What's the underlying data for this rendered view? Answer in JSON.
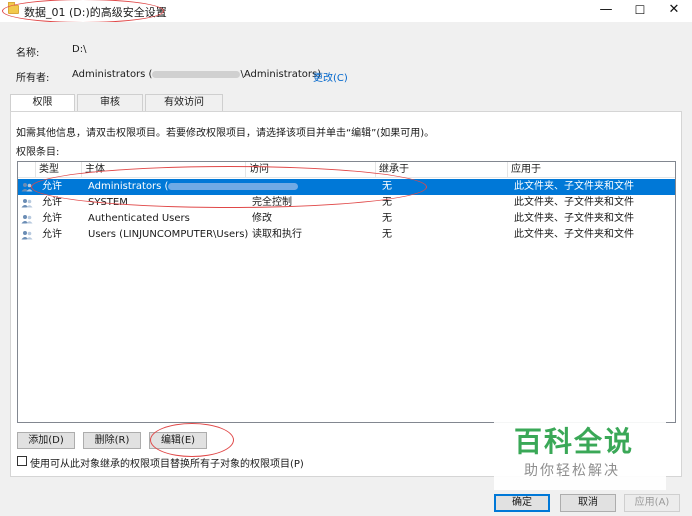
{
  "window": {
    "title": "数据_01 (D:)的高级安全设置",
    "minimize_glyph": "—",
    "maximize_glyph": "☐",
    "close_glyph": "✕"
  },
  "info": {
    "name_label": "名称:",
    "name_value": "D:\\",
    "owner_label": "所有者:",
    "owner_prefix": "Administrators (",
    "owner_suffix": "\\Administrators)",
    "change_link": "更改(C)"
  },
  "tabs": [
    {
      "label": "权限",
      "active": true
    },
    {
      "label": "审核",
      "active": false
    },
    {
      "label": "有效访问",
      "active": false
    }
  ],
  "panel": {
    "instruction": "如需其他信息，请双击权限项目。若要修改权限项目，请选择该项目并单击“编辑”(如果可用)。",
    "entries_label": "权限条目:"
  },
  "table": {
    "columns": [
      "类型",
      "主体",
      "访问",
      "继承于",
      "应用于"
    ],
    "rows": [
      {
        "type": "允许",
        "principal": "Administrators (",
        "access": "",
        "inherited": "无",
        "applies": "此文件夹、子文件夹和文件",
        "selected": true
      },
      {
        "type": "允许",
        "principal": "SYSTEM",
        "access": "完全控制",
        "inherited": "无",
        "applies": "此文件夹、子文件夹和文件",
        "selected": false
      },
      {
        "type": "允许",
        "principal": "Authenticated Users",
        "access": "修改",
        "inherited": "无",
        "applies": "此文件夹、子文件夹和文件",
        "selected": false
      },
      {
        "type": "允许",
        "principal": "Users (LINJUNCOMPUTER\\Users)",
        "access": "读取和执行",
        "inherited": "无",
        "applies": "此文件夹、子文件夹和文件",
        "selected": false
      }
    ]
  },
  "actions": {
    "add": "添加(D)",
    "remove": "删除(R)",
    "edit": "编辑(E)"
  },
  "checkbox_label": "使用可从此对象继承的权限项目替换所有子对象的权限项目(P)",
  "footer": {
    "ok": "确定",
    "cancel": "取消",
    "apply": "应用(A)"
  },
  "watermark": {
    "main": "百科全说",
    "sub": "助你轻松解决"
  },
  "colors": {
    "selection": "#0078d7",
    "link": "#0066cc",
    "annotation": "#e04848",
    "watermark": "#3aa857"
  }
}
